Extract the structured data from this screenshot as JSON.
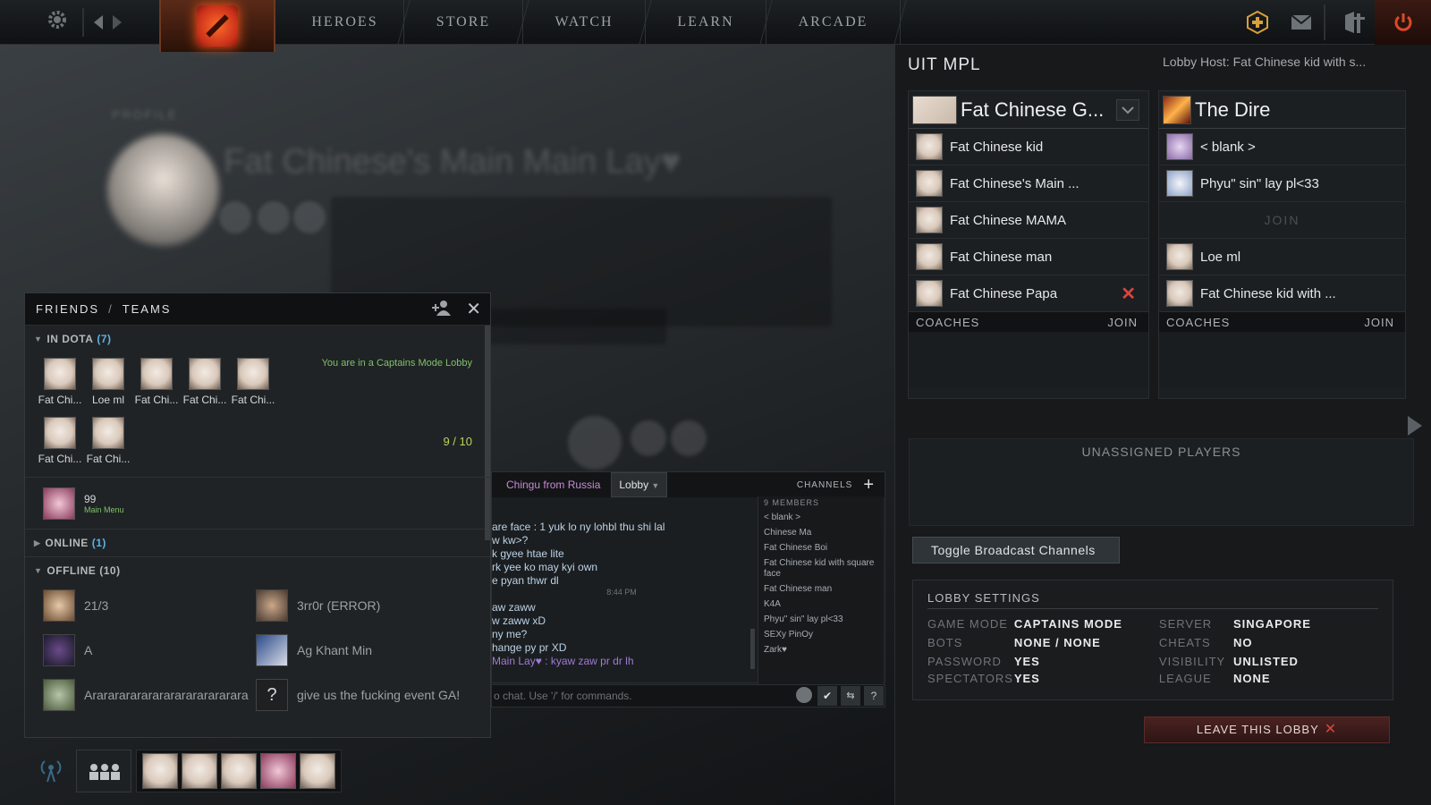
{
  "nav": {
    "tabs": [
      "HEROES",
      "STORE",
      "WATCH",
      "LEARN",
      "ARCADE"
    ],
    "icons": [
      "gear-icon",
      "back-arrow-icon",
      "forward-arrow-icon",
      "dota-logo",
      "plus-currency-icon",
      "mail-icon",
      "armory-icon",
      "power-icon"
    ]
  },
  "background": {
    "profile_label": "PROFILE",
    "profile_name": "Fat Chinese's Main Main Lay♥"
  },
  "lobby": {
    "title": "UIT MPL",
    "host": "Lobby Host: Fat Chinese kid with s...",
    "radiant": {
      "name": "Fat Chinese G...",
      "players": [
        "Fat Chinese kid",
        "Fat Chinese's Main ...",
        "Fat Chinese MAMA",
        "Fat Chinese man",
        "Fat Chinese Papa"
      ],
      "coaches_label": "COACHES",
      "join_label": "JOIN"
    },
    "dire": {
      "name": "The Dire",
      "players": [
        "< blank >",
        "Phyu\" sin\" lay pl<33",
        "JOIN",
        "Loe ml",
        "Fat Chinese kid with ..."
      ],
      "coaches_label": "COACHES",
      "join_label": "JOIN"
    },
    "unassigned_label": "UNASSIGNED PLAYERS",
    "toggle_label": "Toggle Broadcast Channels",
    "settings": {
      "title": "LOBBY SETTINGS",
      "rows": [
        {
          "k1": "GAME MODE",
          "v1": "CAPTAINS MODE",
          "k2": "SERVER",
          "v2": "SINGAPORE"
        },
        {
          "k1": "BOTS",
          "v1": "NONE / NONE",
          "k2": "CHEATS",
          "v2": "NO"
        },
        {
          "k1": "PASSWORD",
          "v1": "YES",
          "k2": "VISIBILITY",
          "v2": "UNLISTED"
        },
        {
          "k1": "SPECTATORS",
          "v1": "YES",
          "k2": "LEAGUE",
          "v2": "NONE"
        }
      ]
    },
    "leave_label": "LEAVE THIS LOBBY"
  },
  "friends": {
    "tab_friends": "FRIENDS",
    "separator": "/",
    "tab_teams": "TEAMS",
    "in_dota_label": "IN DOTA",
    "in_dota_count": "(7)",
    "status_msg": "You are in a Captains Mode Lobby",
    "lobby_count": "9 / 10",
    "in_dota": [
      "Fat Chi...",
      "Loe ml",
      "Fat Chi...",
      "Fat Chi...",
      "Fat Chi...",
      "Fat Chi...",
      "Fat Chi..."
    ],
    "other": {
      "name": "99",
      "status": "Main Menu"
    },
    "online_label": "ONLINE",
    "online_count": "(1)",
    "offline_label": "OFFLINE",
    "offline_count": "(10)",
    "offline": [
      "21/3",
      "3rr0r (ERROR)",
      "A",
      "Ag Khant Min",
      "Arararararararararararararara",
      "give us the fucking event GA!"
    ]
  },
  "chat": {
    "tabs": [
      "Chingu from Russia",
      "Lobby"
    ],
    "channels_label": "CHANNELS",
    "lines": [
      "are face : 1 yuk lo ny lohbl thu shi lal",
      "w kw>?",
      "k gyee htae lite",
      "rk yee ko may kyi own",
      "e pyan thwr dl",
      "8:44 PM",
      "aw zaww",
      "w zaww xD",
      "ny me?",
      "hange py pr XD",
      " Main Lay♥ : kyaw zaw pr dr lh"
    ],
    "members_label": "9 MEMBERS",
    "members": [
      "< blank >",
      "Chinese Ma",
      "Fat Chinese Boi",
      "Fat Chinese kid with square face",
      "Fat Chinese man",
      "K4A",
      "Phyu\" sin\" lay pl<33",
      "SEXy PinOy",
      "Zark♥"
    ],
    "input_placeholder": "o chat. Use '/' for commands."
  }
}
